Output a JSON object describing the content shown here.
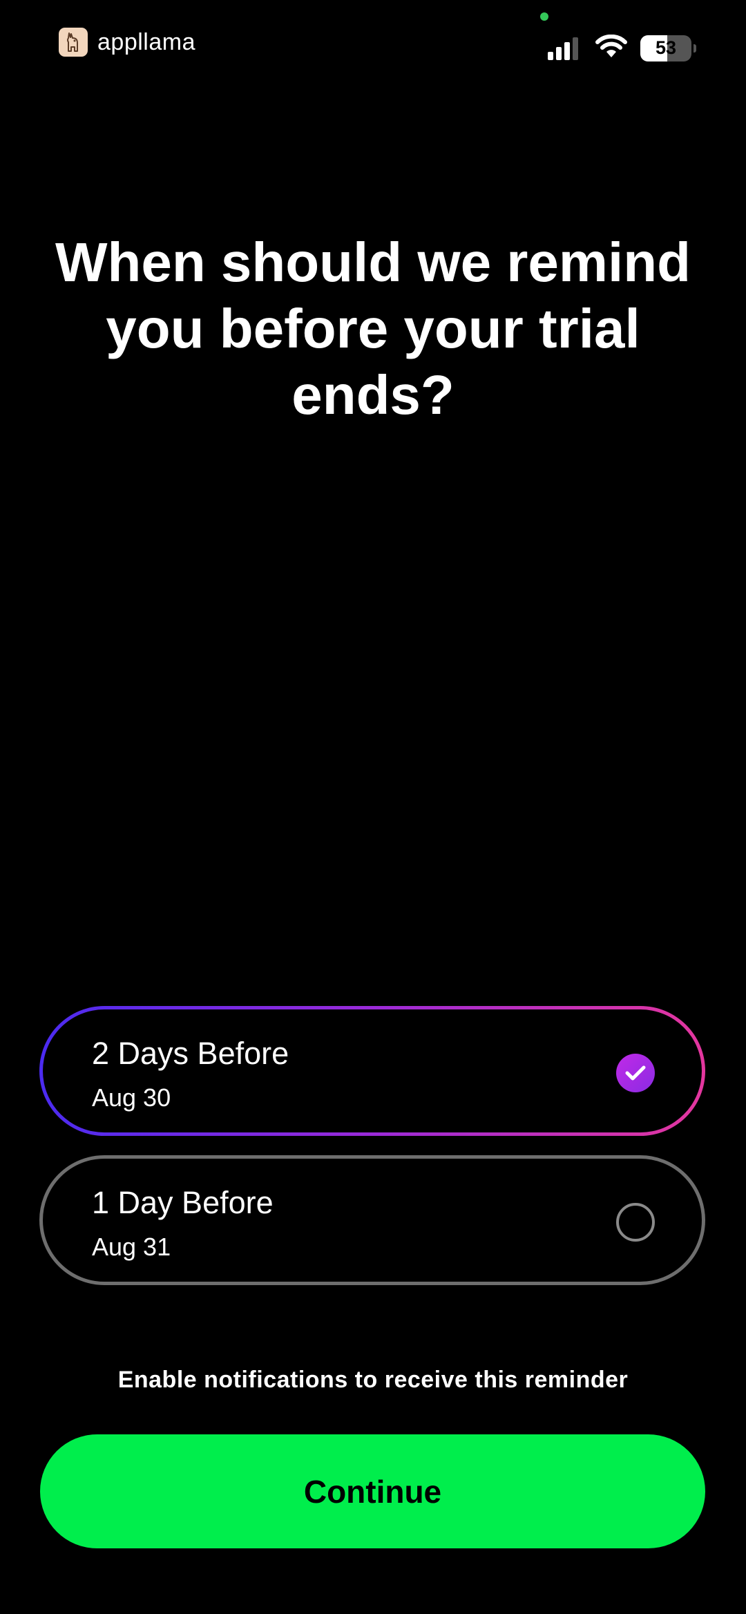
{
  "status_bar": {
    "app_name": "appllama",
    "battery_level": "53",
    "battery_fraction": 0.53,
    "icons": [
      "signal-icon",
      "wifi-icon",
      "battery-icon"
    ],
    "privacy_indicator_color": "#34c759"
  },
  "headline": "When should we remind you before your trial ends?",
  "options": [
    {
      "title": "2 Days Before",
      "date": "Aug 30",
      "selected": true
    },
    {
      "title": "1 Day Before",
      "date": "Aug 31",
      "selected": false
    }
  ],
  "footer": {
    "notification_text": "Enable notifications to receive this reminder",
    "continue_label": "Continue"
  },
  "colors": {
    "background": "#000000",
    "accent_green": "#00ee4c",
    "selected_gradient": [
      "#4b2bf0",
      "#9a2ad8",
      "#e4369e"
    ],
    "unselected_border": "#6e6e6e"
  }
}
